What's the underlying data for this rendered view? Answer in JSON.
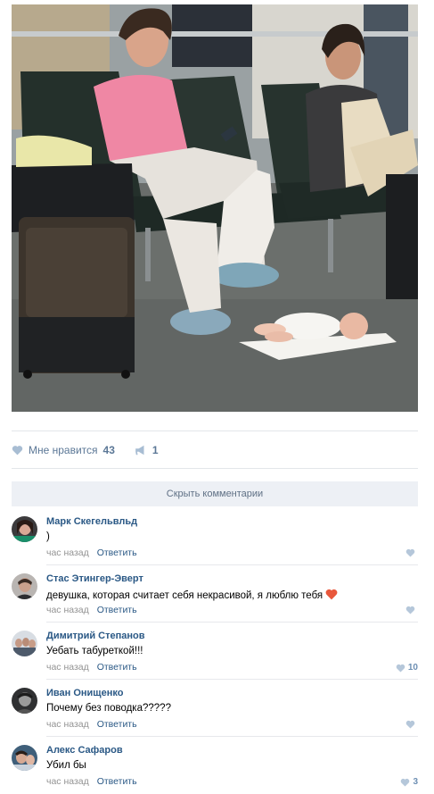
{
  "post": {
    "photo_name": "airport-waiting-area-photo",
    "likes_label": "Мне нравится",
    "likes_count": "43",
    "shares_count": "1",
    "hide_comments_label": "Скрыть комментарии"
  },
  "comments": [
    {
      "author": "Марк Скегельвльд",
      "text": ")",
      "time": "час назад",
      "reply": "Ответить",
      "likes": ""
    },
    {
      "author": "Стас Этингер-Эверт",
      "text": "девушка, которая считает себя некрасивой, я люблю тебя",
      "time": "час назад",
      "reply": "Ответить",
      "likes": ""
    },
    {
      "author": "Димитрий Степанов",
      "text": "Уебать табуреткой!!!",
      "time": "час назад",
      "reply": "Ответить",
      "likes": "10"
    },
    {
      "author": "Иван Онищенко",
      "text": "Почему без поводка?????",
      "time": "час назад",
      "reply": "Ответить",
      "likes": ""
    },
    {
      "author": "Алекс Сафаров",
      "text": "Убил бы",
      "time": "час назад",
      "reply": "Ответить",
      "likes": "3"
    }
  ],
  "colors": {
    "link": "#2a5885",
    "muted": "#939393",
    "like_icon": "#a8bdd3",
    "emoji_heart": "#e8573b"
  }
}
